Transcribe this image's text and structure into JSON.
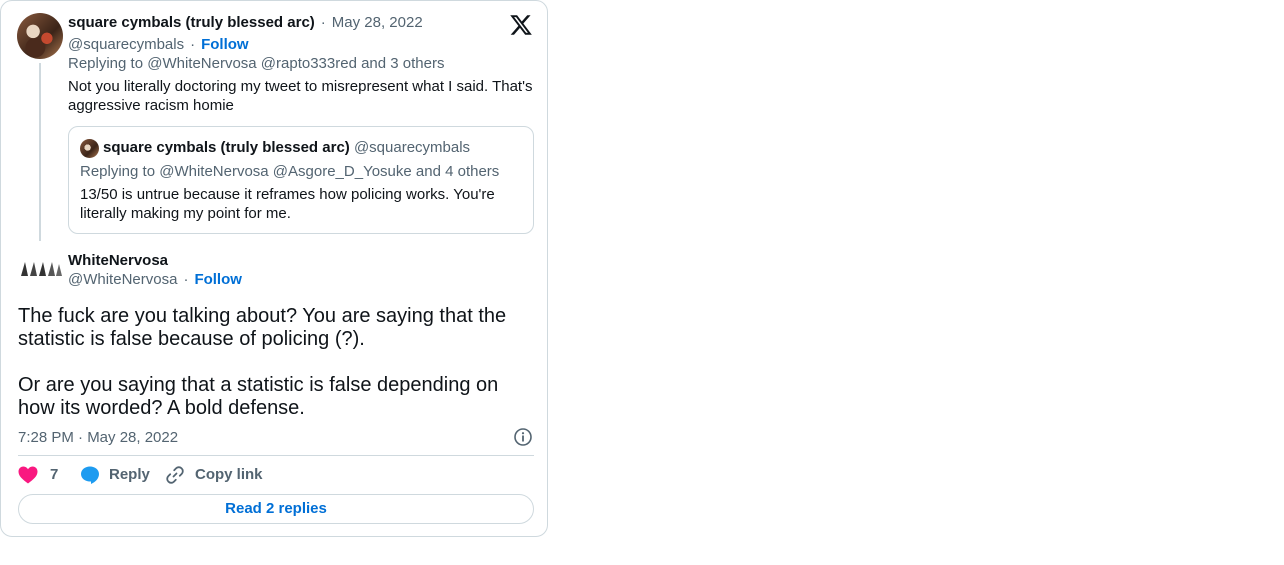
{
  "parent_tweet": {
    "display_name": "square cymbals (truly blessed arc)",
    "date": "May 28, 2022",
    "handle": "@squarecymbals",
    "follow_label": "Follow",
    "replying_to": "Replying to @WhiteNervosa @rapto333red and 3 others",
    "text": "Not you literally doctoring my tweet to misrepresent what I said. That's aggressive racism homie"
  },
  "quoted_tweet": {
    "display_name": "square cymbals (truly blessed arc)",
    "handle": "@squarecymbals",
    "replying_to": "Replying to @WhiteNervosa @Asgore_D_Yosuke and 4 others",
    "text": "13/50 is untrue because it reframes how policing works. You're literally making my point for me."
  },
  "main_tweet": {
    "display_name": "WhiteNervosa",
    "handle": "@WhiteNervosa",
    "follow_label": "Follow",
    "paragraphs": [
      "The fuck are you talking about? You are saying that the statistic is false because of policing (?).",
      "Or are you saying that a statistic is false depending on how its worded? A bold defense."
    ],
    "time": "7:28 PM · May 28, 2022"
  },
  "actions": {
    "like_count": "7",
    "reply_label": "Reply",
    "copy_link_label": "Copy link",
    "read_replies_label": "Read 2 replies"
  },
  "icons": {
    "brand": "x-logo-icon",
    "info": "info-icon",
    "like": "heart-icon",
    "reply": "speech-bubble-icon",
    "copy": "link-icon"
  },
  "colors": {
    "link": "#006fd6",
    "muted": "#536471",
    "heart": "#f91880",
    "reply_bubble": "#1d9bf0",
    "border": "#cfd9de"
  }
}
